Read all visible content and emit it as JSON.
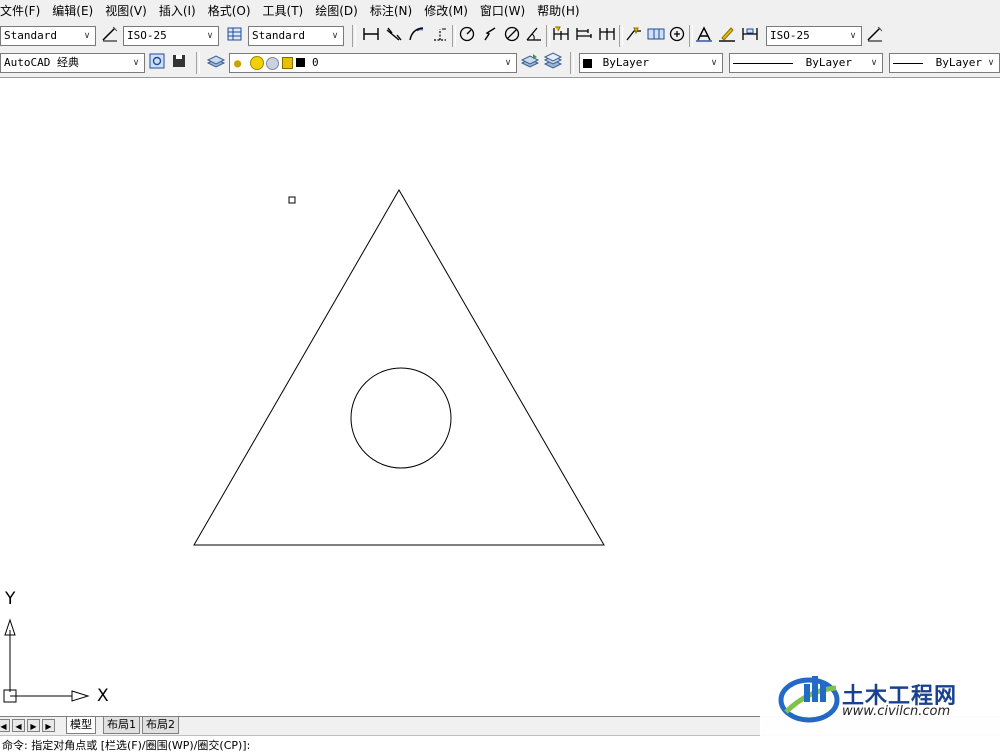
{
  "menu": [
    "文件(F)",
    "编辑(E)",
    "视图(V)",
    "插入(I)",
    "格式(O)",
    "工具(T)",
    "绘图(D)",
    "标注(N)",
    "修改(M)",
    "窗口(W)",
    "帮助(H)"
  ],
  "styles_toolbar": {
    "text_style": "Standard",
    "dim_style": "ISO-25",
    "table_style": "Standard",
    "dim_style_2": "ISO-25"
  },
  "workspace": "AutoCAD 经典",
  "layer": {
    "name": "0"
  },
  "properties": {
    "color": "ByLayer",
    "linetype": "ByLayer",
    "lineweight": "ByLayer"
  },
  "drawing": {
    "shapes": [
      "triangle",
      "circle"
    ],
    "stroke_color": "#000000",
    "background": "#ffffff"
  },
  "ucs": {
    "x_label": "X",
    "y_label": "Y"
  },
  "tabs": {
    "model": "模型",
    "layout1": "布局1",
    "layout2": "布局2"
  },
  "command_line": "命令: 指定对角点或 [栏选(F)/圈围(WP)/圈交(CP)]:",
  "watermark": {
    "title": "土木工程网",
    "url": "www.civilcn.com"
  },
  "icons": [
    "text-style-icon",
    "dim-style-icon",
    "table-style-icon",
    "linear-dim-icon",
    "aligned-dim-icon",
    "arc-length-icon",
    "ordinate-dim-icon",
    "radius-dim-icon",
    "jogged-dim-icon",
    "diameter-dim-icon",
    "angular-dim-icon",
    "quick-dim-icon",
    "baseline-dim-icon",
    "continue-dim-icon",
    "leader-icon",
    "tolerance-icon",
    "center-mark-icon",
    "dim-edit-icon",
    "dim-text-edit-icon",
    "dim-update-icon",
    "layer-manager-icon",
    "layer-previous-icon",
    "layer-states-icon"
  ]
}
